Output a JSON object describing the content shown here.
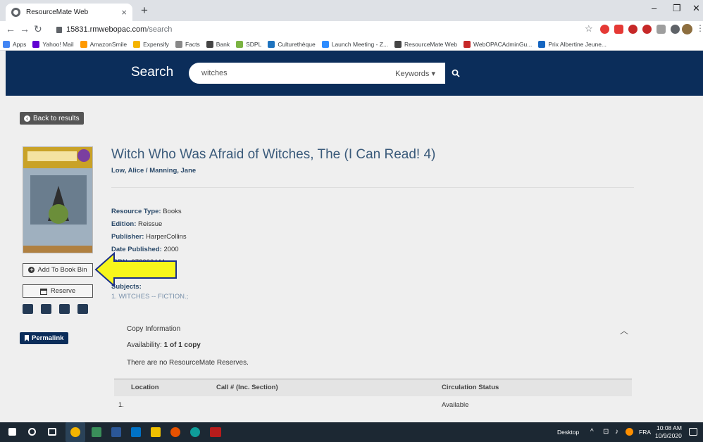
{
  "browser": {
    "tab_title": "ResourceMate Web",
    "url_host": "15831.rmwebopac.com",
    "url_path": "/search",
    "bookmarks": [
      "Apps",
      "Yahoo! Mail",
      "AmazonSmile",
      "Expensify",
      "Facts",
      "Bank",
      "SDPL",
      "Culturethèque",
      "Launch Meeting - Z...",
      "ResourceMate Web",
      "WebOPACAdminGu...",
      "Prix Albertine Jeune..."
    ],
    "bookmark_colors": [
      "#4285f4",
      "#6001d2",
      "#ff9900",
      "#f5b400",
      "#888888",
      "#444444",
      "#7bb342",
      "#1e73be",
      "#2d8cff",
      "#444444",
      "#c62828",
      "#1565c0"
    ]
  },
  "search": {
    "label": "Search",
    "query": "witches",
    "mode": "Keywords ▾"
  },
  "nav": {
    "back_label": "Back to results"
  },
  "book": {
    "title": "Witch Who Was Afraid of Witches, The (I Can Read! 4)",
    "authors": "Low, Alice / Manning, Jane",
    "fields": [
      {
        "label": "Resource Type:",
        "value": "Books"
      },
      {
        "label": "Edition:",
        "value": "Reissue"
      },
      {
        "label": "Publisher:",
        "value": "HarperCollins"
      },
      {
        "label": "Date Published:",
        "value": "2000"
      },
      {
        "label": "ISBN:",
        "value": "978006444..."
      }
    ],
    "subjects_label": "Subjects:",
    "subjects_value": "1. WITCHES -- FICTION.;"
  },
  "actions": {
    "add_label": "Add To Book Bin",
    "reserve_label": "Reserve",
    "permalink_label": "Permalink"
  },
  "copy": {
    "title": "Copy Information",
    "availability_label": "Availability:",
    "availability_value": "1 of 1 copy",
    "reserves_note": "There are no ResourceMate Reserves.",
    "columns": [
      "Location",
      "Call # (Inc. Section)",
      "Circulation Status"
    ],
    "rows": [
      {
        "index": "1.",
        "call": "",
        "status": "Available"
      }
    ]
  },
  "taskbar": {
    "desktop_label": "Desktop",
    "lang": "FRA",
    "time": "10:08 AM",
    "date": "10/9/2020"
  }
}
